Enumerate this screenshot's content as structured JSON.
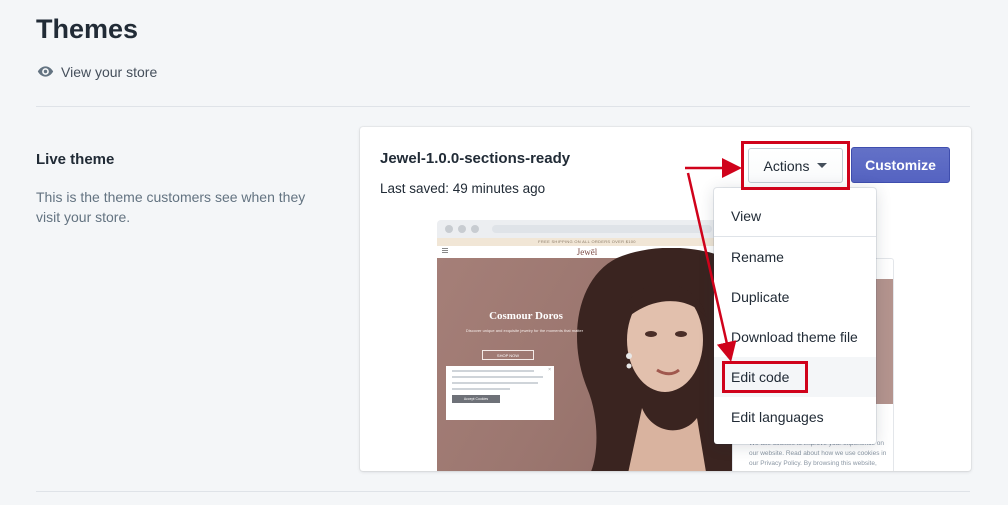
{
  "page": {
    "title": "Themes",
    "view_store_label": "View your store"
  },
  "live_theme": {
    "title": "Live theme",
    "description": "This is the theme customers see when they visit your store."
  },
  "theme": {
    "name": "Jewel-1.0.0-sections-ready",
    "last_saved": "Last saved: 49 minutes ago",
    "actions_label": "Actions",
    "customize_label": "Customize"
  },
  "preview": {
    "promo_text": "FREE SHIPPING ON ALL ORDERS OVER $100",
    "logo": "Jewēl",
    "hero_title": "Cosmour Doros",
    "hero_subtitle": "Discover unique and exquisite jewelry for the moments that matter",
    "hero_button": "SHOP NOW",
    "cookie_button": "Accept Cookies",
    "mobile_cookie_text": "We use cookies to improve your experience on our website. Read about how we use cookies in our Privacy Policy. By browsing this website, you"
  },
  "actions_menu": {
    "items": [
      {
        "label": "View"
      },
      {
        "label": "Rename"
      },
      {
        "label": "Duplicate"
      },
      {
        "label": "Download theme file"
      },
      {
        "label": "Edit code"
      },
      {
        "label": "Edit languages"
      }
    ]
  },
  "colors": {
    "accent": "#5c6ac4",
    "annotation": "#d0021b",
    "background": "#f4f6f8"
  },
  "icons": {
    "view_store": "eye-icon",
    "actions": "caret-down-icon"
  }
}
